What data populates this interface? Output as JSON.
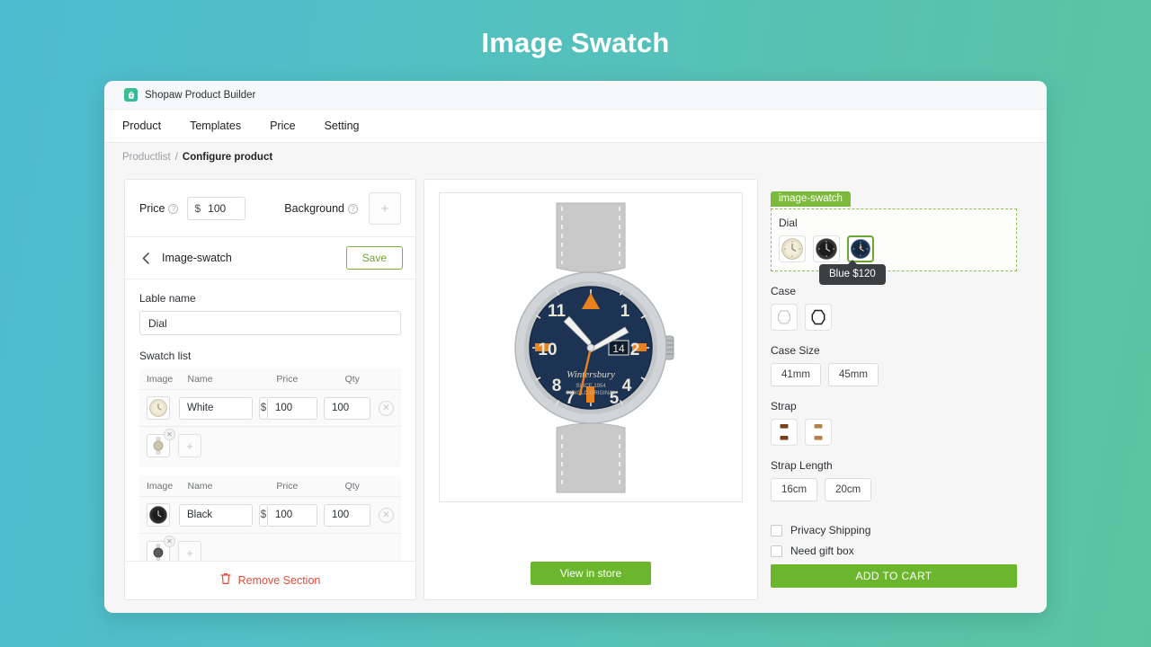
{
  "page": {
    "title": "Image Swatch"
  },
  "brand": {
    "name": "Shopaw Product Builder",
    "logo_icon": "shopping-bag-icon"
  },
  "nav": {
    "items": [
      "Product",
      "Templates",
      "Price",
      "Setting"
    ]
  },
  "breadcrumb": {
    "parent": "Productlist",
    "separator": "/",
    "current": "Configure product"
  },
  "editor": {
    "price_label": "Price",
    "price_currency": "$",
    "price_value": "100",
    "background_label": "Background",
    "background_add_icon": "plus-icon",
    "back_icon": "chevron-left-icon",
    "section_title": "Image-swatch",
    "save_label": "Save",
    "label_name_heading": "Lable name",
    "label_name_value": "Dial",
    "swatch_list_heading": "Swatch list",
    "columns": [
      "Image",
      "Name",
      "Price",
      "Qty"
    ],
    "rows": [
      {
        "name": "White",
        "currency": "$",
        "price": "100",
        "qty": "100",
        "thumb": "white-dial-thumb",
        "delete_icon": "remove-row-icon",
        "add_icon": "plus-icon",
        "add_thumb": "watch-thumb"
      },
      {
        "name": "Black",
        "currency": "$",
        "price": "100",
        "qty": "100",
        "thumb": "black-dial-thumb",
        "delete_icon": "remove-row-icon",
        "add_icon": "plus-icon",
        "add_thumb": "watch-thumb"
      }
    ],
    "remove_section_label": "Remove Section",
    "remove_section_icon": "trash-icon"
  },
  "preview": {
    "product_image": "blue-dial-pilot-watch",
    "view_in_store_label": "View in store"
  },
  "options": {
    "badge": "image-swatch",
    "tooltip": "Blue $120",
    "groups": [
      {
        "label": "Dial",
        "type": "image",
        "items": [
          {
            "name": "white-dial-swatch",
            "selected": false
          },
          {
            "name": "black-dial-swatch",
            "selected": false
          },
          {
            "name": "blue-dial-swatch",
            "selected": true
          }
        ]
      },
      {
        "label": "Case",
        "type": "image",
        "items": [
          {
            "name": "case-light-swatch",
            "selected": false
          },
          {
            "name": "case-dark-swatch",
            "selected": false
          }
        ]
      },
      {
        "label": "Case Size",
        "type": "pill",
        "items": [
          "41mm",
          "45mm"
        ]
      },
      {
        "label": "Strap",
        "type": "image",
        "items": [
          {
            "name": "strap-dark-brown-swatch",
            "selected": false
          },
          {
            "name": "strap-light-brown-swatch",
            "selected": false
          }
        ]
      },
      {
        "label": "Strap Length",
        "type": "pill",
        "items": [
          "16cm",
          "20cm"
        ]
      }
    ],
    "checkboxes": [
      "Privacy Shipping",
      "Need gift box"
    ],
    "add_to_cart_label": "ADD TO CART"
  },
  "colors": {
    "accent_green": "#6cb62e",
    "badge_green": "#7cb93c",
    "danger_red": "#e74c3c",
    "bg_left": "#4dbcd0",
    "bg_right": "#5bc49f"
  }
}
